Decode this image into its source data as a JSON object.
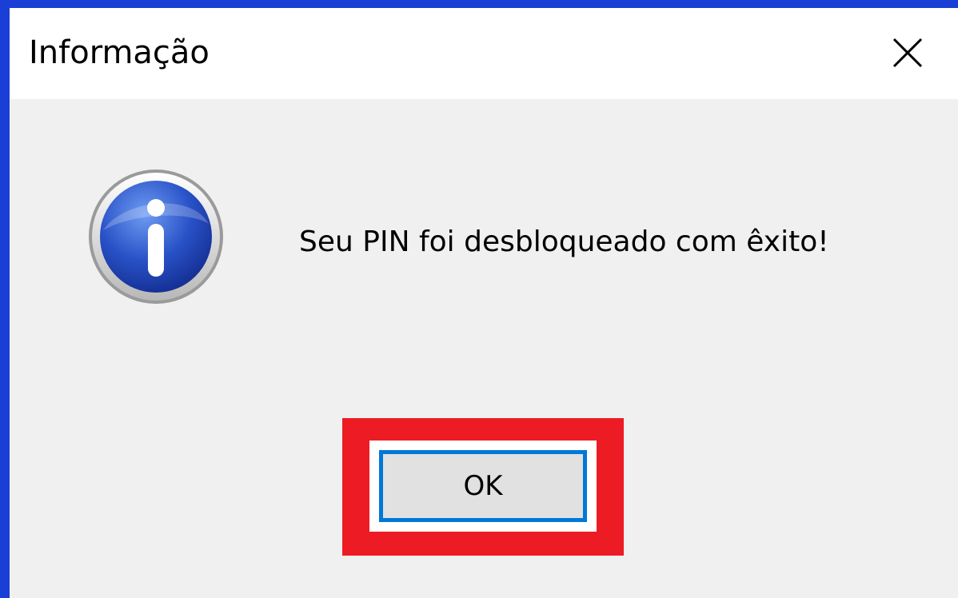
{
  "dialog": {
    "title": "Informação",
    "close_icon": "close-icon",
    "message_icon": "info-icon",
    "message": "Seu PIN foi desbloqueado com êxito!",
    "ok_label": "OK"
  },
  "colors": {
    "desktop_background": "#1a3fd6",
    "title_bar": "#ffffff",
    "dialog_body": "#f0f0f0",
    "highlight_frame": "#ed1c24",
    "button_focus_border": "#0078d7",
    "button_face": "#e1e1e1"
  }
}
